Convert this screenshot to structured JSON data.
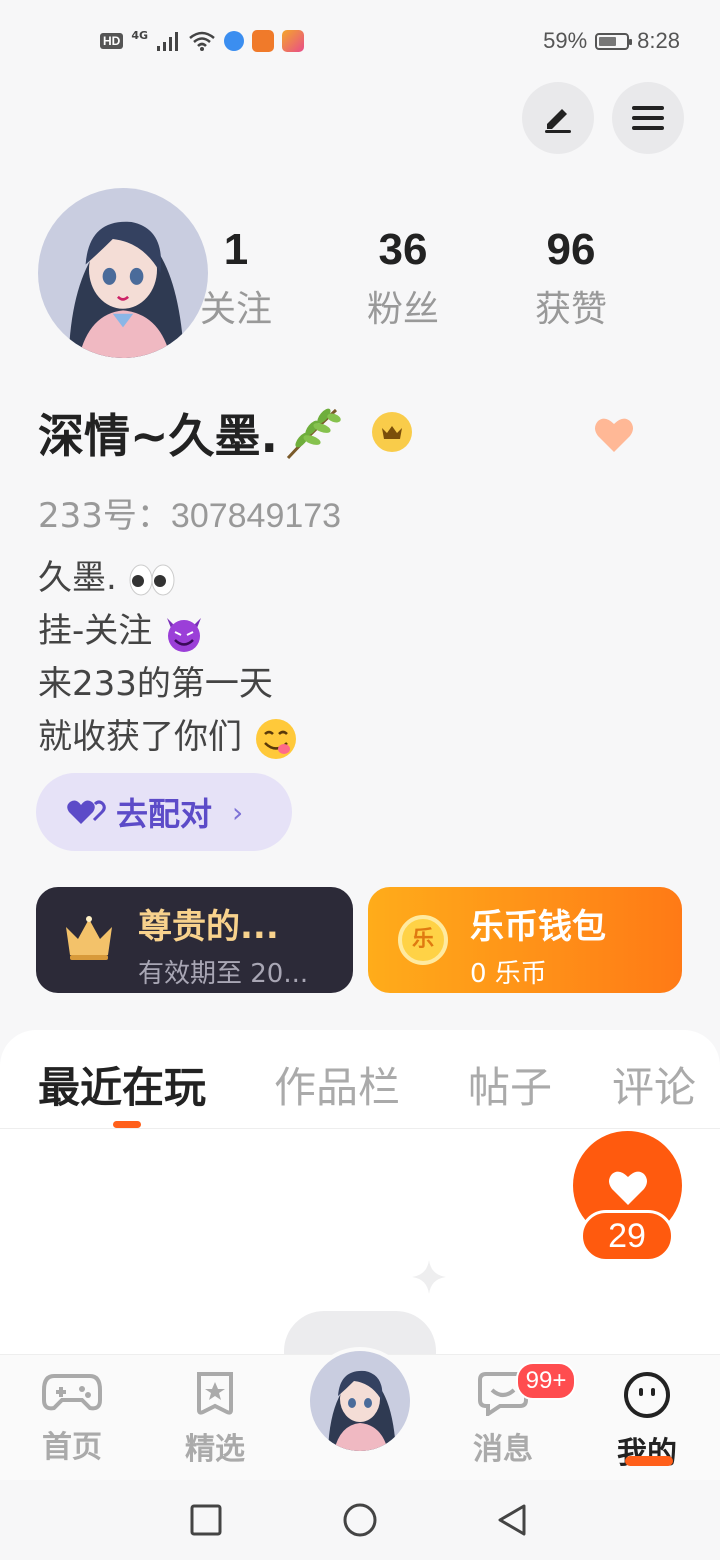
{
  "status_bar": {
    "hd": "HD",
    "network": "4G",
    "battery": "59%",
    "time": "8:28"
  },
  "profile": {
    "stats": [
      {
        "num": "1",
        "label": "关注"
      },
      {
        "num": "36",
        "label": "粉丝"
      },
      {
        "num": "96",
        "label": "获赞"
      }
    ],
    "username": "深情~久墨.",
    "uid_label": "233号：",
    "uid_value": "307849173",
    "bio_lines": [
      "久墨.",
      "挂-关注",
      "来233的第一天",
      "就收获了你们"
    ],
    "match_label": "去配对"
  },
  "cards": {
    "vip_title": "尊贵的...",
    "vip_sub": "有效期至 20...",
    "coin_title": "乐币钱包",
    "coin_sub": "0 乐币",
    "coin_glyph": "乐"
  },
  "tabs": [
    "最近在玩",
    "作品栏",
    "帖子",
    "评论"
  ],
  "likes": {
    "count": "29"
  },
  "bottom_nav": {
    "items": [
      {
        "label": "首页",
        "icon": "gamepad-icon"
      },
      {
        "label": "精选",
        "icon": "star-bookmark-icon"
      },
      {
        "label": "消息",
        "icon": "chat-icon"
      },
      {
        "label": "我的",
        "icon": "smiley-icon"
      }
    ],
    "message_badge": "99+"
  },
  "colors": {
    "accent": "#ff5a0e",
    "match_bg": "#e6e2f7",
    "vip_card": "#2c2a38",
    "coin_card": "#ff9a18"
  }
}
